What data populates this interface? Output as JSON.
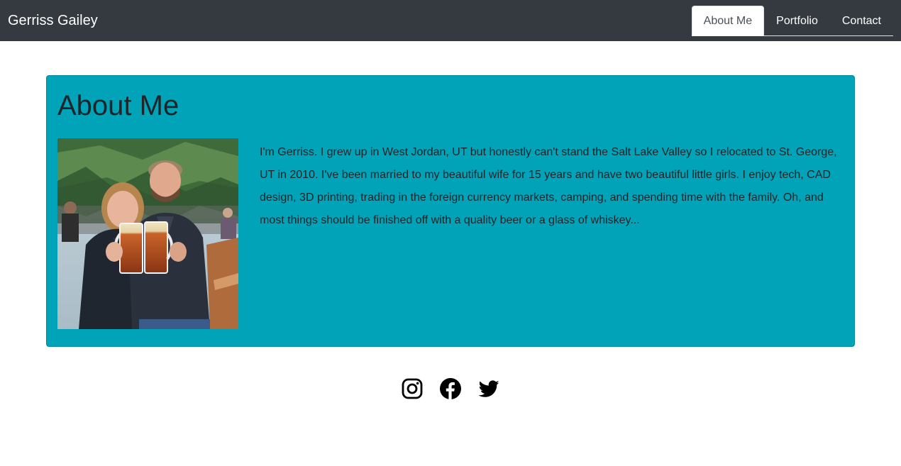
{
  "navbar": {
    "brand": "Gerriss Gailey",
    "links": [
      {
        "label": "About Me",
        "active": true
      },
      {
        "label": "Portfolio",
        "active": false
      },
      {
        "label": "Contact",
        "active": false
      }
    ]
  },
  "about": {
    "title": "About Me",
    "photo_alt": "Photo of Gerriss and his wife holding beer steins outdoors",
    "bio": "I'm Gerriss. I grew up in West Jordan, UT but honestly can't stand the Salt Lake Valley so I relocated to St. George, UT in 2010. I've been married to my beautiful wife for 15 years and have two beautiful little girls. I enjoy tech, CAD design, 3D printing, trading in the foreign currency markets, camping, and spending time with the family. Oh, and most things should be finished off with a quality beer or a glass of whiskey..."
  },
  "social": [
    {
      "name": "instagram-icon"
    },
    {
      "name": "facebook-icon"
    },
    {
      "name": "twitter-icon"
    }
  ],
  "colors": {
    "navbar_bg": "#343a40",
    "card_bg": "#00a3b8",
    "text": "#212529"
  }
}
